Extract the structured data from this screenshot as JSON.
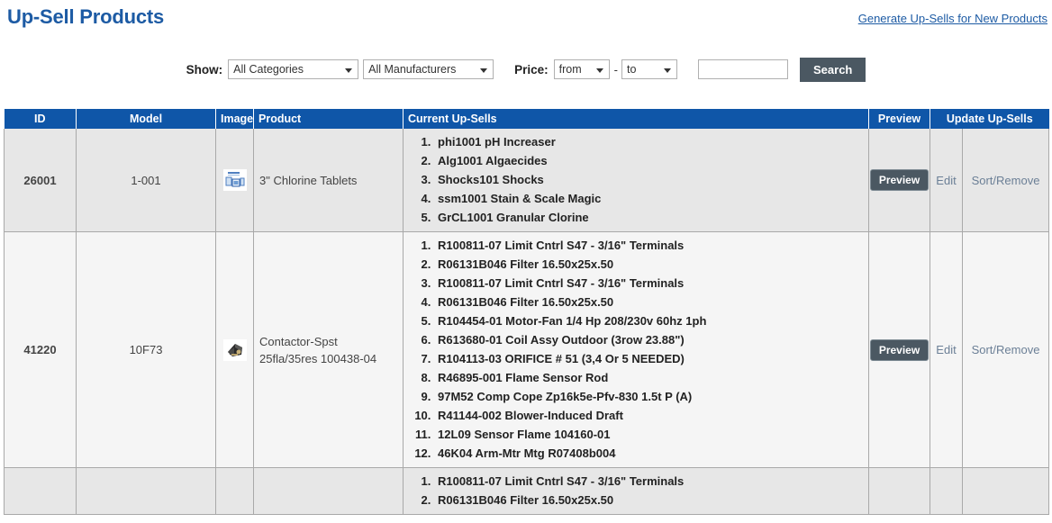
{
  "header": {
    "title": "Up-Sell Products",
    "generate_link": "Generate Up-Sells for New Products"
  },
  "filters": {
    "show_label": "Show:",
    "categories_value": "All Categories",
    "manufacturers_value": "All Manufacturers",
    "price_label": "Price:",
    "price_from_value": "from",
    "price_separator": "-",
    "price_to_value": "to",
    "search_input_value": "",
    "search_input_placeholder": "",
    "search_button": "Search"
  },
  "table": {
    "columns": {
      "id": "ID",
      "model": "Model",
      "image": "Image",
      "product": "Product",
      "upsells": "Current Up-Sells",
      "preview": "Preview",
      "update": "Update Up-Sells"
    },
    "actions": {
      "preview": "Preview",
      "edit": "Edit",
      "sort_remove": "Sort/Remove"
    },
    "rows": [
      {
        "id": "26001",
        "model": "1-001",
        "image_icon": "chlorine-tablets-thumbnail",
        "product": "3\" Chlorine Tablets",
        "upsells": [
          "phi1001 pH Increaser",
          "Alg1001 Algaecides",
          "Shocks101 Shocks",
          "ssm1001 Stain & Scale Magic",
          "GrCL1001 Granular Clorine"
        ]
      },
      {
        "id": "41220",
        "model": "10F73",
        "image_icon": "contactor-thumbnail",
        "product": "Contactor-Spst 25fla/35res 100438-04",
        "upsells": [
          "R100811-07 Limit Cntrl S47 - 3/16\" Terminals",
          "R06131B046 Filter 16.50x25x.50",
          "R100811-07 Limit Cntrl S47 - 3/16\" Terminals",
          "R06131B046 Filter 16.50x25x.50",
          "R104454-01 Motor-Fan 1/4 Hp 208/230v 60hz 1ph",
          "R613680-01 Coil Assy Outdoor (3row 23.88\")",
          "R104113-03 ORIFICE # 51 (3,4 Or 5 NEEDED)",
          "R46895-001 Flame Sensor Rod",
          "97M52 Comp Cope Zp16k5e-Pfv-830 1.5t P (A)",
          "R41144-002 Blower-Induced Draft",
          "12L09 Sensor Flame 104160-01",
          "46K04 Arm-Mtr Mtg R07408b004"
        ]
      },
      {
        "id": "",
        "model": "",
        "image_icon": "",
        "product": "",
        "upsells": [
          "R100811-07 Limit Cntrl S47 - 3/16\" Terminals",
          "R06131B046 Filter 16.50x25x.50"
        ]
      }
    ]
  },
  "colors": {
    "title_blue": "#1d5ba4",
    "header_blue": "#0f56a8",
    "button_slate": "#4b5862",
    "link_gray_blue": "#6b7f96"
  }
}
